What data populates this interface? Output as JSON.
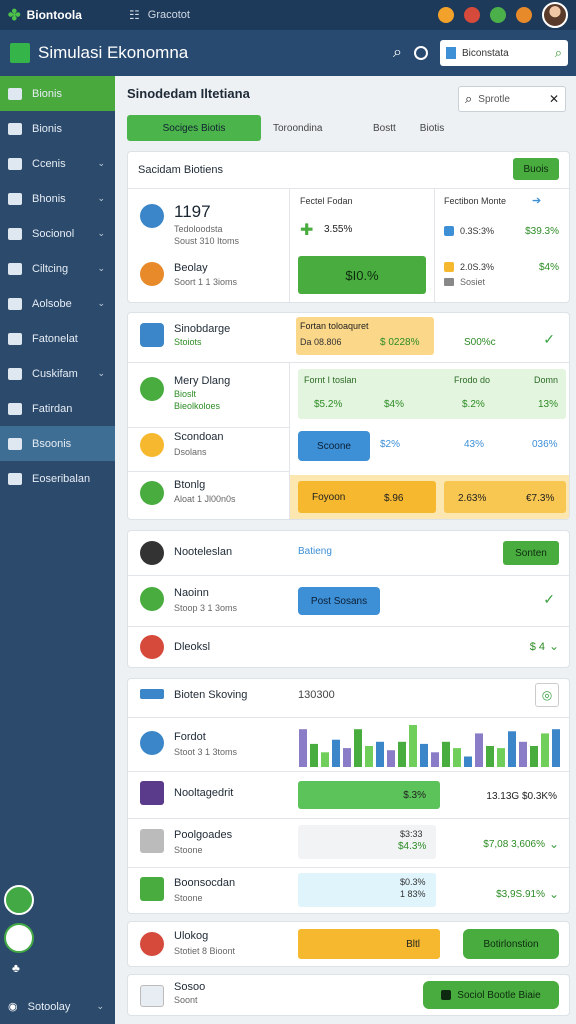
{
  "topbar": {
    "app_name": "Biontoola",
    "breadcrumb": "Gracotot"
  },
  "header": {
    "title": "Simulasi Ekonomna",
    "search_value": "Biconstata"
  },
  "sidebar": {
    "items": [
      {
        "label": "Bionis",
        "chevron": false
      },
      {
        "label": "Bionis",
        "chevron": false
      },
      {
        "label": "Ccenis",
        "chevron": true
      },
      {
        "label": "Bhonis",
        "chevron": true
      },
      {
        "label": "Socionol",
        "chevron": true
      },
      {
        "label": "Ciltcing",
        "chevron": true
      },
      {
        "label": "Aolsobe",
        "chevron": true
      },
      {
        "label": "Fatonelat",
        "chevron": false
      },
      {
        "label": "Cuskifam",
        "chevron": true
      },
      {
        "label": "Fatirdan",
        "chevron": false
      },
      {
        "label": "Bsoonis",
        "chevron": false
      },
      {
        "label": "Eoseribalan",
        "chevron": false
      }
    ],
    "bottom_label": "Sotoolay"
  },
  "main": {
    "heading": "Sinodedam Iltetiana",
    "search_placeholder": "Sprotle",
    "tabs": [
      "Sociges Biotis",
      "Toroondina",
      "Bostt",
      "Biotis"
    ],
    "card1": {
      "title": "Sacidam Biotiens",
      "button": "Buois",
      "big_value": "1197",
      "big_sub1": "Tedoloodsta",
      "big_sub2": "Soust 310 Itoms",
      "item2_label": "Beolay",
      "item2_sub": "Soort 1 1 3ioms",
      "mid_title": "Fectel Fodan",
      "mid_value": "3.55%",
      "mid_button": "$I0.%",
      "right_title": "Fectibon Monte",
      "right_r1a": "0.3S:3%",
      "right_r1b": "$39.3%",
      "right_r2a": "2.0S.3%",
      "right_r2b": "$4%",
      "right_r3": "Sosiet"
    },
    "card2": {
      "title": "Sinobdarge",
      "title_sub": "Stoiots",
      "hl_title": "Fortan toloaquret",
      "hl_sub": "Da 08.806",
      "hl_value": "$ 0228%",
      "hl_right": "S00%c",
      "r1_label": "Mery Dlang",
      "r1_sub1": "Bioslt",
      "r1_sub2": "Bieolkoloes",
      "g_h1": "Fornt I toslan",
      "g_h2": "Frodo do",
      "g_h3": "Domn",
      "g_v1": "$5.2%",
      "g_v2": "$4%",
      "g_v3": "$.2%",
      "g_v4": "13%",
      "r2_label": "Scondoan",
      "r2_sub": "Dsolans",
      "r2_btn": "Scoone",
      "r2_v1": "$2%",
      "r2_v2": "43%",
      "r2_v3": "036%",
      "r3_label": "Btonlg",
      "r3_sub": "Aloat 1 Jl00n0s",
      "r3_btn": "Foyoon",
      "r3_v1": "$.96",
      "r3_v2": "2.63%",
      "r3_v3": "€7.3%"
    },
    "card3": {
      "title": "Nooteleslan",
      "link": "Batieng",
      "button": "Sonten",
      "r1_label": "Naoinn",
      "r1_sub": "Stoop 3 1 3oms",
      "r1_btn": "Post Sosans",
      "r2_label": "Dleoksl",
      "r2_value": "$ 4"
    },
    "card4": {
      "title": "Bioten Skoving",
      "number": "130300",
      "r1_label": "Fordot",
      "r1_sub": "Stoot 3 1 3toms",
      "r2_label": "Nooltagedrit",
      "r2_bar": "$.3%",
      "r2_right": "13.13G $0.3K%",
      "r3_label": "Poolgoades",
      "r3_sub": "Stoone",
      "r3_bar_top": "$3:33",
      "r3_bar": "$4.3%",
      "r3_right": "$7,08 3,606%",
      "r4_label": "Boonsocdan",
      "r4_sub": "Stoone",
      "r4_bar_top": "$0.3%",
      "r4_bar": "1 83%",
      "r4_right": "$3,9S.91%",
      "spark": [
        0.9,
        0.55,
        0.35,
        0.65,
        0.45,
        0.9,
        0.5,
        0.6,
        0.4,
        0.6,
        1.0,
        0.55,
        0.35,
        0.6,
        0.45,
        0.25,
        0.8,
        0.5,
        0.45,
        0.85,
        0.6,
        0.5,
        0.8,
        0.9
      ]
    },
    "card5": {
      "label": "Ulokog",
      "sub": "Stotiet 8 Bioont",
      "yellow_btn": "Bltl",
      "green_btn": "Botirlonstion"
    },
    "card6": {
      "label": "Sosoo",
      "sub": "Soont",
      "button": "Sociol Bootle Biaie"
    }
  },
  "colors": {
    "nav_bg": "#2c4a6c",
    "accent_green": "#49ac3e",
    "accent_blue": "#3d8fd6",
    "accent_yellow": "#f5b82e"
  }
}
